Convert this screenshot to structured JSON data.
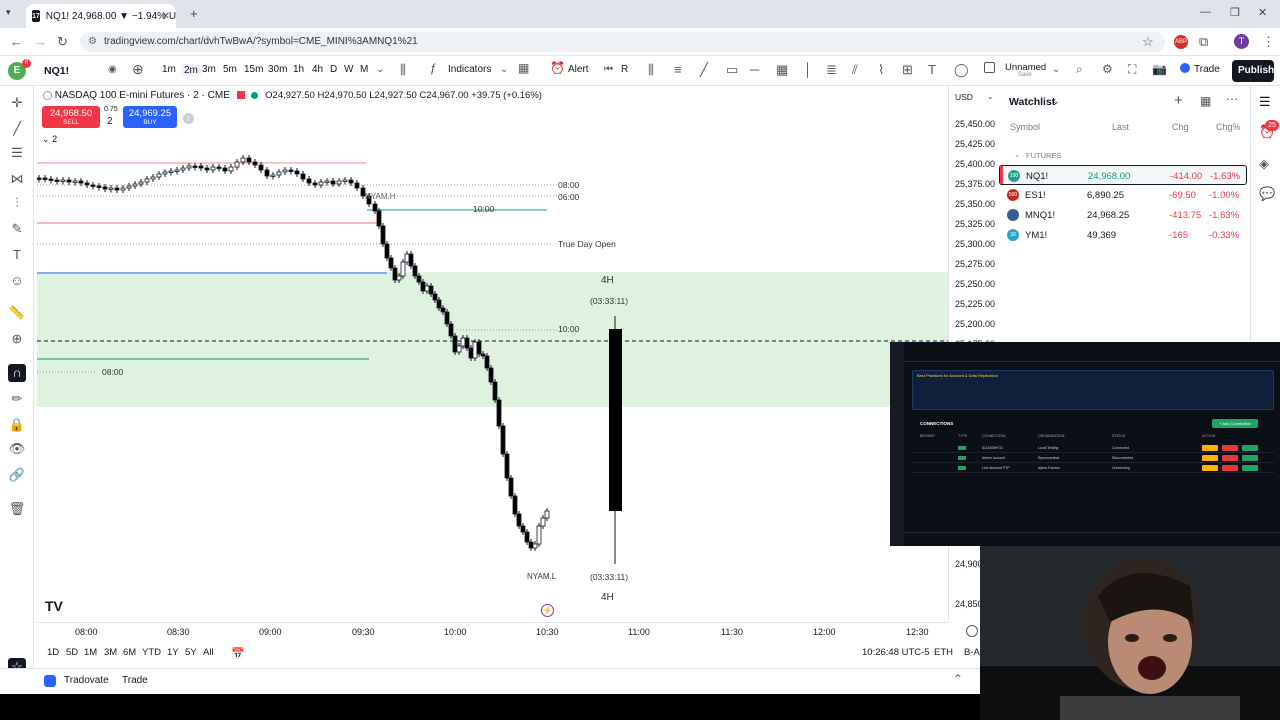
{
  "browser": {
    "tab_title": "NQ1! 24,968.00 ▼ −1.94% Unn",
    "url": "tradingview.com/chart/dvhTwBwA/?symbol=CME_MINI%3AMNQ1%21",
    "ext_badge": "T"
  },
  "toolbar": {
    "symbol": "NQ1!",
    "intervals": [
      "1m",
      "2m",
      "3m",
      "5m",
      "15m",
      "30m",
      "1h",
      "4h",
      "D",
      "W",
      "M"
    ],
    "indicators": "Indicators",
    "alert": "Alert",
    "replay": "R",
    "layout_name": "Unnamed",
    "layout_sub": "Save",
    "trade": "Trade",
    "publish": "Publish"
  },
  "legend": {
    "title": "NASDAQ 100 E-mini Futures · 2 · CME",
    "ohlc": "O24,927.50 H24,970.50 L24,927.50 C24,967.00 +39.75 (+0.16%)",
    "sell_price": "24,968.50",
    "sell_label": "SELL",
    "spread": "0.75",
    "qty": "2",
    "buy_price": "24,969.25",
    "buy_label": "BUY",
    "indicator_count": "2"
  },
  "annotations": {
    "l0800a": "08:00",
    "l0600": "06:00",
    "l1000a": "10:00",
    "true_day_open": "True Day Open",
    "nyam_h": "NYAM.H",
    "h4_top": "4H",
    "timer_top": "(03:33:11)",
    "l1000b": "10:00",
    "l0800b": "08:00",
    "nyam_l": "NYAM.L",
    "timer_bottom": "(03:33:11)",
    "h4_bottom": "4H"
  },
  "price_axis": {
    "currency": "USD",
    "labels": [
      "25,450.00",
      "25,425.00",
      "25,400.00",
      "25,375.00",
      "25,350.00",
      "25,325.00",
      "25,300.00",
      "25,275.00",
      "25,250.00",
      "25,225.00",
      "25,200.00",
      "25,175.00",
      "24,900",
      "24,850"
    ]
  },
  "time_axis": [
    "08:00",
    "08:30",
    "09:00",
    "09:30",
    "10:00",
    "10:30",
    "11:00",
    "11:30",
    "12:00",
    "12:30"
  ],
  "bottom_bar": {
    "ranges": [
      "1D",
      "5D",
      "1M",
      "3M",
      "6M",
      "YTD",
      "1Y",
      "5Y",
      "All"
    ],
    "clock": "10:26:48 UTC-5",
    "session": "ETH",
    "extra": "B-A"
  },
  "footer": {
    "broker": "Tradovate",
    "trade": "Trade"
  },
  "watchlist": {
    "title": "Watchlist",
    "cols": [
      "Symbol",
      "Last",
      "Chg",
      "Chg%"
    ],
    "section": "FUTURES",
    "notif": "25",
    "rows": [
      {
        "symbol": "NQ1!",
        "last": "24,968.00",
        "chg": "-414.00",
        "chgp": "-1.63%",
        "icon": "100",
        "color": "#2a9d8f"
      },
      {
        "symbol": "ES1!",
        "last": "6,890.25",
        "chg": "-69.50",
        "chgp": "-1.00%",
        "icon": "500",
        "color": "#c62828"
      },
      {
        "symbol": "MNQ1!",
        "last": "24,968.25",
        "chg": "-413.75",
        "chgp": "-1.63%",
        "icon": "flag",
        "color": "#3b5998"
      },
      {
        "symbol": "YM1!",
        "last": "49,369",
        "chg": "-165",
        "chgp": "-0.33%",
        "icon": "30",
        "color": "#26a6c8"
      }
    ]
  },
  "overlay": {
    "section_title": "Best Practices for Account & Data Replication",
    "connections": "CONNECTIONS",
    "add": "+ Add Connection",
    "headers": [
      "BROKER",
      "TYPE",
      "CONNECTION",
      "ORGANIZATION",
      "STATUS",
      "ACTION"
    ],
    "rows": [
      {
        "conn": "ID1A03HFO1",
        "org": "Local Testing",
        "status": "Connected"
      },
      {
        "conn": "Admin account",
        "org": "Rymcrowdnar",
        "status": "Disconnected"
      },
      {
        "conn": "Live Account PTP",
        "org": "Alpha Futures",
        "status": "Connecting"
      }
    ]
  },
  "colors": {
    "up": "#ffffff",
    "down": "#000000",
    "zone": "#dff1df",
    "red": "#f23645",
    "green": "#089981",
    "blue": "#2962ff"
  }
}
